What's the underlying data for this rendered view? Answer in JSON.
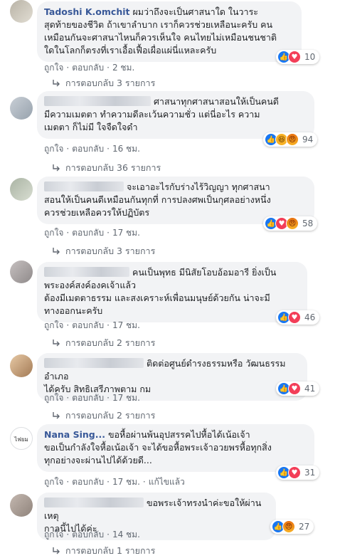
{
  "comments": [
    {
      "name": "Tadoshi K.omchit",
      "text": "ผมว่าถึงจะเป็นศาสนาใด ในวาระสุดท้ายของชีวิต ถ้าเขาลำบาก เราก็ควรช่วยเหลือนะครับ คนเหมือนกันจะศาสนาไหนก็ควรเห็นใจ คนไทยไม่เหมือนชนชาติใดในโลกก็ตรงที่เราเอื้อเฟื้อเผื่อแผ่นี่แหละครับ",
      "lines": [
        "ผมว่าถึงจะเป็นศาสนาใด ในวาระ",
        "สุดท้ายของชีวิต ถ้าเขาลำบาก เราก็ควรช่วยเหลือนะครับ คน",
        "เหมือนกันจะศาสนาไหนก็ควรเห็นใจ คนไทยไม่เหมือนชนชาติ",
        "ใดในโลกก็ตรงที่เราเอื้อเฟื้อเผื่อแผ่นี่แหละครับ"
      ],
      "reaction_count": "10",
      "like": "ถูกใจ",
      "reply": "ตอบกลับ",
      "time": "2 ชม.",
      "replies_label": "การตอบกลับ 3 รายการ"
    },
    {
      "name": "",
      "lines": [
        "ศาสนาทุกศาสนาสอนให้เป็นคนดี",
        "มีความเมตตา ทำความดีละเว้นความชั่ว แต่นี่อะไร ความ",
        "เมตตา ก็ไม่มี ใจจืดใจดำ"
      ],
      "reaction_count": "94",
      "like": "ถูกใจ",
      "reply": "ตอบกลับ",
      "time": "16 ชม.",
      "replies_label": "การตอบกลับ 36 รายการ"
    },
    {
      "name": "",
      "lines": [
        "จะเอาอะไรกับร่างไร้วิญญา ทุกศาสนา",
        "สอนให้เป็นคนดีเหมือนกันทุกที่ การปลงศพเป็นกุศลอย่างหนึ่ง",
        "ควรช่วยเหลือควรให้ปฏิบัตร"
      ],
      "reaction_count": "58",
      "like": "ถูกใจ",
      "reply": "ตอบกลับ",
      "time": "17 ชม.",
      "replies_label": "การตอบกลับ 3 รายการ"
    },
    {
      "name": "",
      "lines": [
        "คนเป็นพุทธ มีนิสัยโอบอ้อมอารี ยิ่งเป็น",
        "พระองค์สงค์องคเจ้าแล้ว",
        "ต้องมีเมตตาธรรม และสงเคราะห์เพื่อนมนุษย์ด้วยกัน น่าจะมี",
        "ทางออกนะครับ"
      ],
      "reaction_count": "46",
      "like": "ถูกใจ",
      "reply": "ตอบกลับ",
      "time": "17 ชม.",
      "replies_label": "การตอบกลับ 2 รายการ"
    },
    {
      "name": "",
      "lines": [
        "ติดต่อศูนย์ดำรงธรรมหรือ วัฒนธรรมอำเภอ",
        "ได้ครับ สิทธิเสรีภาพตาม กม"
      ],
      "reaction_count": "41",
      "like": "ถูกใจ",
      "reply": "ตอบกลับ",
      "time": "17 ชม.",
      "replies_label": "การตอบกลับ 2 รายการ"
    },
    {
      "name": "Nana Sing...",
      "avatar_text": "ไฟยม",
      "lines": [
        "ขอหื้อผ่านพ้นอุปสรรคไปหื้อได้เน้อเจ้า",
        "ขอเป็นกำลังใจหื้อเน้อเจ้า จะได้ขอหื้อพระเจ้าอวยพรหื้อทุกสิ่ง",
        "ทุกอย่างจะผ่านไปได้ด้วยดี..."
      ],
      "reaction_count": "31",
      "like": "ถูกใจ",
      "reply": "ตอบกลับ",
      "time": "17 ชม.",
      "edited": "แก้ไขแล้ว"
    },
    {
      "name": "",
      "lines": [
        "ขอพระเจ้าทรงนำค่ะขอให้ผ่านเหตุ",
        "กาลนี้ไปได้ค่ะ"
      ],
      "reaction_count": "27",
      "like": "ถูกใจ",
      "reply": "ตอบกลับ",
      "time": "14 ชม.",
      "replies_label": "การตอบกลับ 1 รายการ"
    }
  ],
  "colors": {
    "link": "#385898",
    "muted": "#606770",
    "bubble": "#f2f3f5",
    "like": "#1877f2",
    "love": "#f33e58",
    "haha": "#f7b125"
  },
  "icons": {
    "reply_arrow": "reply-arrow-icon",
    "like": "like-reaction-icon",
    "love": "love-reaction-icon",
    "haha": "haha-reaction-icon",
    "angry": "angry-reaction-icon"
  }
}
